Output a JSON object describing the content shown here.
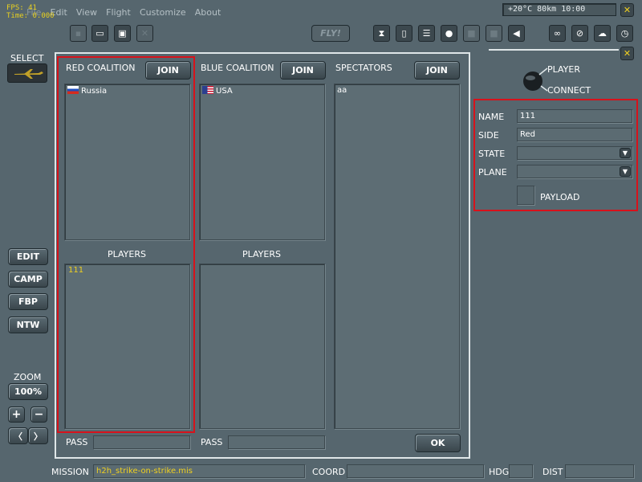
{
  "menu": {
    "items": [
      "File",
      "Edit",
      "View",
      "Flight",
      "Customize",
      "About"
    ]
  },
  "overlay": {
    "fps": "FPS: 41",
    "time": "Time: 0.000"
  },
  "weather": {
    "readout": "+20°C  80km 10:00"
  },
  "toolbar": {
    "fly_label": "FLY!"
  },
  "left": {
    "select_label": "SELECT",
    "edit_label": "EDIT",
    "camp_label": "CAMP",
    "fbp_label": "FBP",
    "ntw_label": "NTW",
    "zoom_label": "ZOOM",
    "zoom_value": "100%",
    "zoom_in": "+",
    "zoom_out": "−",
    "nav_left": "〈",
    "nav_right": "〉"
  },
  "red": {
    "title": "RED COALITION",
    "join": "JOIN",
    "country": "Russia",
    "players_title": "PLAYERS",
    "players": [
      "111"
    ],
    "pass_label": "PASS"
  },
  "blue": {
    "title": "BLUE COALITION",
    "join": "JOIN",
    "country": "USA",
    "players_title": "PLAYERS",
    "pass_label": "PASS"
  },
  "spectators": {
    "title": "SPECTATORS",
    "join": "JOIN",
    "items": [
      "aa"
    ]
  },
  "ok_label": "OK",
  "player": {
    "title": "PLAYER",
    "connect": "CONNECT",
    "name_label": "NAME",
    "name_value": "111",
    "side_label": "SIDE",
    "side_value": "Red",
    "state_label": "STATE",
    "state_value": "",
    "plane_label": "PLANE",
    "plane_value": "",
    "payload_label": "PAYLOAD"
  },
  "status": {
    "mission_label": "MISSION",
    "mission_value": "h2h_strike-on-strike.mis",
    "coord_label": "COORD",
    "coord_value": "",
    "hdg_label": "HDG",
    "hdg_value": "",
    "dist_label": "DIST",
    "dist_value": ""
  },
  "colors": {
    "accent_red": "#d8121b",
    "highlight_yellow": "#f0d020",
    "background": "#56666e"
  }
}
